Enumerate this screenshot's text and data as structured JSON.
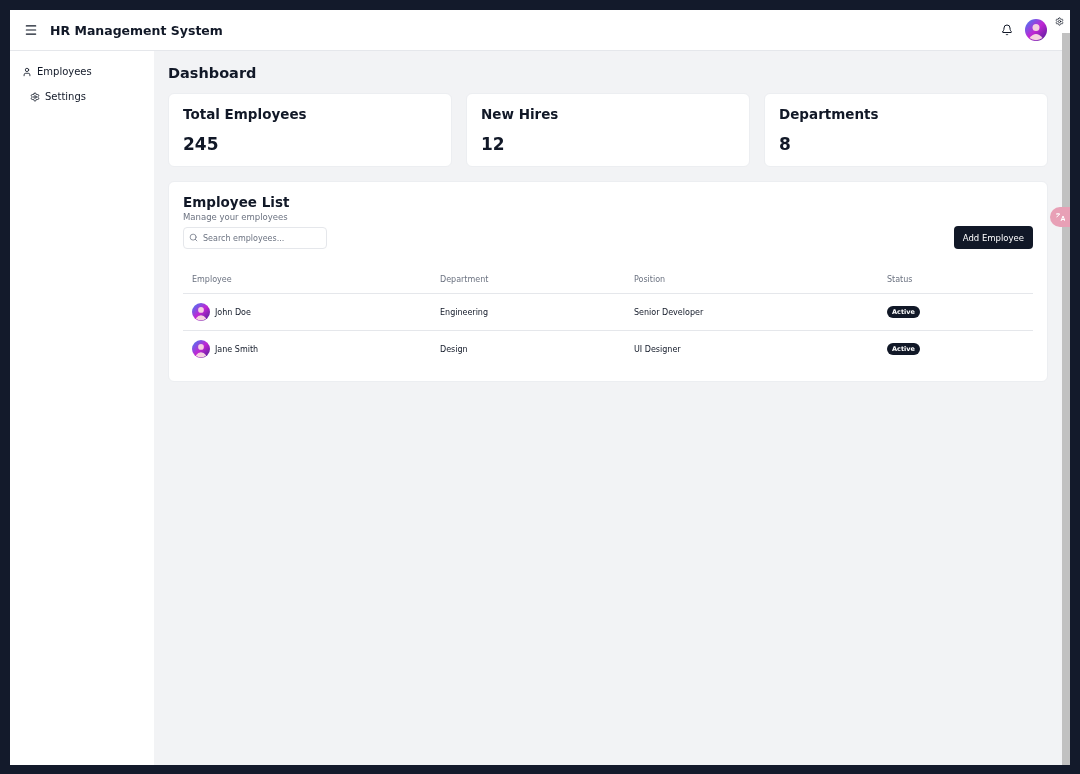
{
  "header": {
    "title": "HR Management System"
  },
  "sidebar": {
    "items": [
      {
        "label": "Employees",
        "kind": "user"
      },
      {
        "label": "Settings",
        "kind": "gear"
      }
    ]
  },
  "page_title": "Dashboard",
  "stats": [
    {
      "label": "Total Employees",
      "value": "245"
    },
    {
      "label": "New Hires",
      "value": "12"
    },
    {
      "label": "Departments",
      "value": "8"
    }
  ],
  "employee_list": {
    "title": "Employee List",
    "subtitle": "Manage your employees",
    "search": {
      "placeholder": "Search employees..."
    },
    "add_button": "Add Employee",
    "columns": [
      "Employee",
      "Department",
      "Position",
      "Status"
    ],
    "rows": [
      {
        "name": "John Doe",
        "department": "Engineering",
        "position": "Senior Developer",
        "status": "Active"
      },
      {
        "name": "Jane Smith",
        "department": "Design",
        "position": "UI Designer",
        "status": "Active"
      }
    ]
  }
}
